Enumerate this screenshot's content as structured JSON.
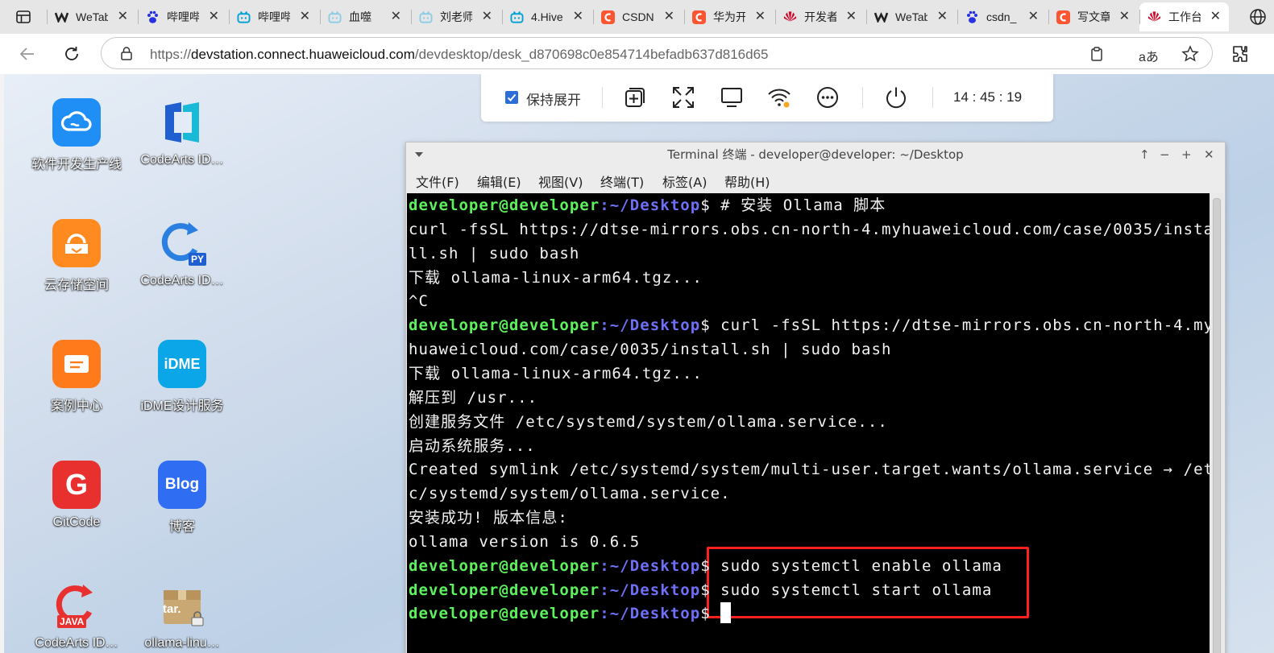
{
  "browser": {
    "tabs": [
      {
        "title": "WeTab",
        "icon": "wetab-icon",
        "color": "#222222"
      },
      {
        "title": "哔哩哔哩",
        "icon": "baidu-paw-icon",
        "color": "#2932e1"
      },
      {
        "title": "哔哩哔哩",
        "icon": "bilibili-icon",
        "color": "#00a1d6"
      },
      {
        "title": "血噬",
        "icon": "bilibili-icon",
        "color": "#8ccde6"
      },
      {
        "title": "刘老师",
        "icon": "bilibili-icon",
        "color": "#8ccde6"
      },
      {
        "title": "4.Hive",
        "icon": "bilibili-icon",
        "color": "#00a1d6"
      },
      {
        "title": "CSDN",
        "icon": "csdn-icon",
        "color": "#fc5531"
      },
      {
        "title": "华为开",
        "icon": "csdn-icon",
        "color": "#fc5531"
      },
      {
        "title": "开发者",
        "icon": "huawei-icon",
        "color": "#cf0a2c"
      },
      {
        "title": "WeTab",
        "icon": "wetab-icon",
        "color": "#222222"
      },
      {
        "title": "csdn_",
        "icon": "baidu-paw-icon",
        "color": "#2932e1"
      },
      {
        "title": "写文章",
        "icon": "csdn-icon",
        "color": "#fc5531"
      },
      {
        "title": "工作台",
        "icon": "huawei-icon",
        "color": "#cf0a2c",
        "active": true
      }
    ],
    "url_prefix": "https://",
    "url_host": "devstation.connect.huaweicloud.com",
    "url_path": "/devdesktop/desk_d870698c0e854714befadb637d816d65"
  },
  "remote_toolbar": {
    "keep_expanded_label": "保持展开",
    "keep_expanded_checked": true,
    "time": "14 : 45 : 19"
  },
  "desktop_icons": [
    {
      "label": "软件开发生产线",
      "icon": "devops-cloud-icon"
    },
    {
      "label": "CodeArts ID…",
      "icon": "codearts-ide-icon"
    },
    {
      "label": "云存储空间",
      "icon": "cloud-storage-icon"
    },
    {
      "label": "CodeArts ID…",
      "icon": "codearts-python-icon",
      "badge": "PY"
    },
    {
      "label": "案例中心",
      "icon": "case-center-icon"
    },
    {
      "label": "iDME设计服务",
      "icon": "idme-icon",
      "badge": "iDME"
    },
    {
      "label": "GitCode",
      "icon": "gitcode-icon",
      "badge": "G"
    },
    {
      "label": "博客",
      "icon": "blog-icon",
      "badge": "Blog"
    },
    {
      "label": "CodeArts ID…",
      "icon": "codearts-java-icon",
      "badge": "JAVA"
    },
    {
      "label": "ollama-linu…",
      "icon": "tar-archive-icon",
      "badge": "tar."
    }
  ],
  "terminal": {
    "title": "Terminal 终端 - developer@developer: ~/Desktop",
    "menu": [
      "文件(F)",
      "编辑(E)",
      "视图(V)",
      "终端(T)",
      "标签(A)",
      "帮助(H)"
    ],
    "prompt_user": "developer@developer",
    "prompt_path": ":~/Desktop",
    "prompt_sign": "$",
    "lines": [
      {
        "prompt": true,
        "text": " # 安装 Ollama 脚本"
      },
      {
        "prompt": false,
        "text": "curl -fsSL https://dtse-mirrors.obs.cn-north-4.myhuaweicloud.com/case/0035/insta"
      },
      {
        "prompt": false,
        "text": "ll.sh | sudo bash"
      },
      {
        "prompt": false,
        "text": "下载 ollama-linux-arm64.tgz..."
      },
      {
        "prompt": false,
        "text": "^C"
      },
      {
        "prompt": true,
        "text": " curl -fsSL https://dtse-mirrors.obs.cn-north-4.my"
      },
      {
        "prompt": false,
        "text": "huaweicloud.com/case/0035/install.sh | sudo bash"
      },
      {
        "prompt": false,
        "text": "下载 ollama-linux-arm64.tgz..."
      },
      {
        "prompt": false,
        "text": "解压到 /usr..."
      },
      {
        "prompt": false,
        "text": "创建服务文件 /etc/systemd/system/ollama.service..."
      },
      {
        "prompt": false,
        "text": "启动系统服务..."
      },
      {
        "prompt": false,
        "text": "Created symlink /etc/systemd/system/multi-user.target.wants/ollama.service → /et"
      },
      {
        "prompt": false,
        "text": "c/systemd/system/ollama.service."
      },
      {
        "prompt": false,
        "text": "安装成功! 版本信息:"
      },
      {
        "prompt": false,
        "text": "ollama version is 0.6.5"
      },
      {
        "prompt": true,
        "text": " sudo systemctl enable ollama"
      },
      {
        "prompt": true,
        "text": " sudo systemctl start ollama"
      },
      {
        "prompt": true,
        "text": " ",
        "cursor": true
      }
    ]
  },
  "colors": {
    "prompt_user": "#5df25d",
    "prompt_path": "#6f6ff7",
    "highlight_box": "#ff2020",
    "toolbar_check": "#2b6fd6"
  }
}
